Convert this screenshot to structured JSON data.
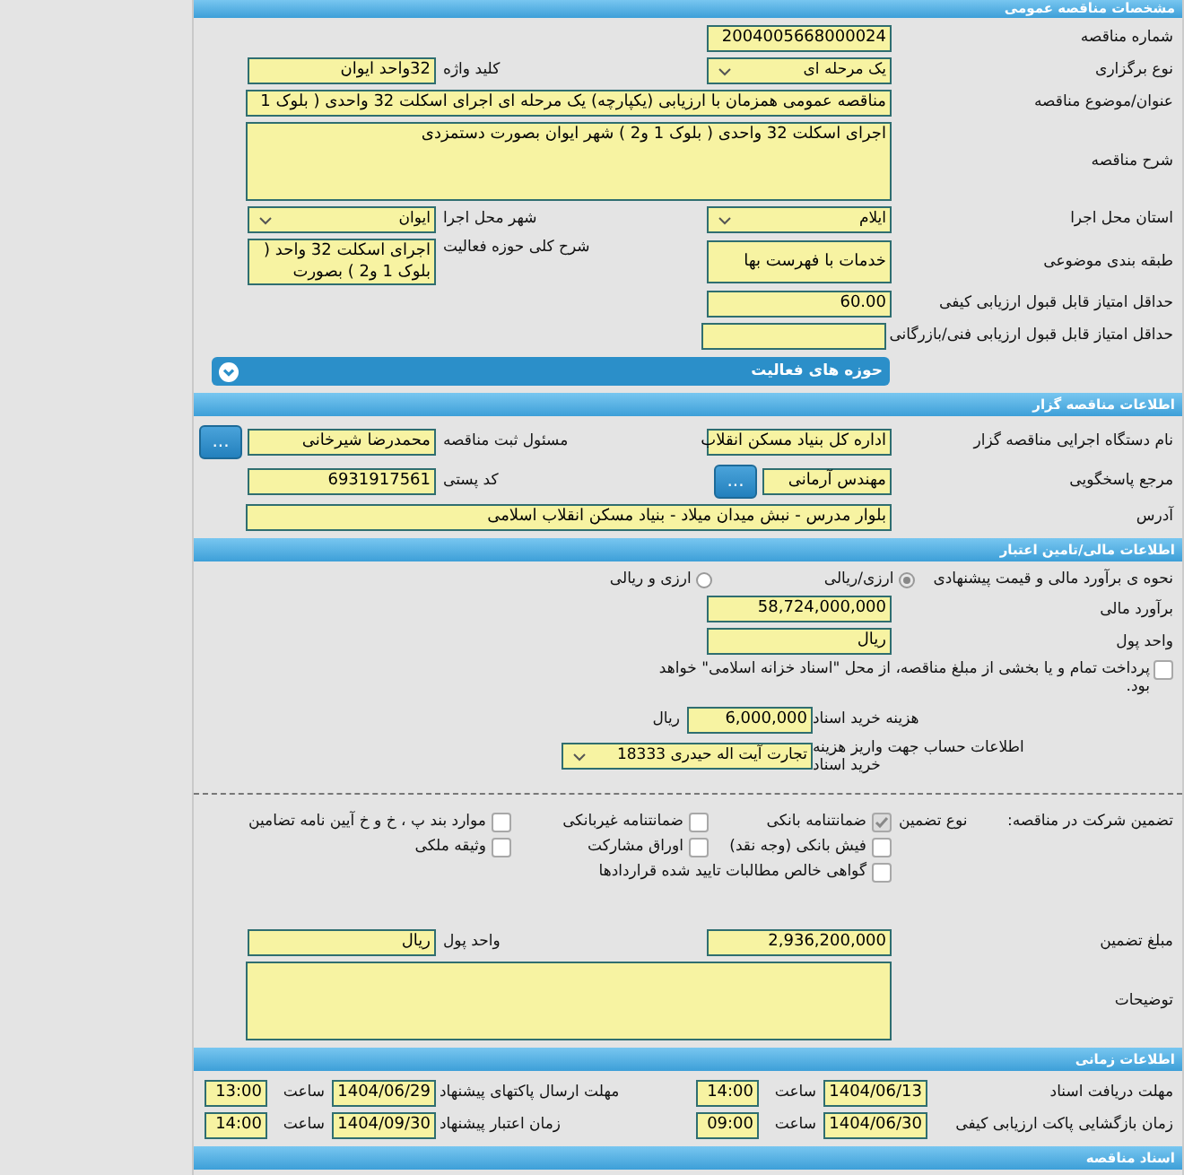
{
  "sections": [
    {
      "title": "مشخصات مناقصه عمومی",
      "rows": [
        {
          "kind": "pair",
          "right": {
            "label": "شماره مناقصه",
            "kind": "text",
            "value": "2004005668000024"
          }
        },
        {
          "kind": "pair",
          "right": {
            "label": "نوع برگزاری",
            "kind": "select",
            "value": "یک مرحله ای"
          },
          "left": {
            "label": "کلید واژه",
            "kind": "text",
            "value": "32واحد ایوان"
          }
        },
        {
          "kind": "wide",
          "label": "عنوان/موضوع مناقصه",
          "field": {
            "kind": "text",
            "value": "مناقصه عمومی همزمان با ارزیابی (یکپارچه) یک مرحله ای اجرای اسکلت 32 واحدی  ( بلوک 1"
          }
        },
        {
          "kind": "wide",
          "label": "شرح مناقصه",
          "field": {
            "kind": "textarea",
            "value": "اجرای اسکلت 32 واحدی  ( بلوک 1 و2 ) شهر ایوان بصورت دستمزدی"
          }
        },
        {
          "kind": "pair",
          "right": {
            "label": "استان محل اجرا",
            "kind": "select",
            "value": "ایلام"
          },
          "left": {
            "label": "شهر محل اجرا",
            "kind": "select",
            "value": "ایوان"
          }
        },
        {
          "kind": "pair",
          "right": {
            "label": "طبقه بندی موضوعی",
            "kind": "text",
            "value": "خدمات با فهرست بها"
          },
          "left": {
            "label": "شرح کلی حوزه فعالیت",
            "kind": "textarea",
            "value": "اجرای اسکلت 32 واحد  ( بلوک 1 و2 ) بصورت"
          }
        },
        {
          "kind": "pair",
          "right": {
            "label": "حداقل امتیاز قابل قبول ارزیابی کیفی",
            "kind": "text",
            "value": "60.00"
          }
        },
        {
          "kind": "pair",
          "right": {
            "label": "حداقل امتیاز قابل قبول ارزیابی فنی/بازرگانی",
            "kind": "text"
          }
        },
        {
          "kind": "collapsible",
          "title": "حوزه های فعالیت",
          "expanded": false
        }
      ]
    },
    {
      "title": "اطلاعات مناقصه گزار",
      "rows": [
        {
          "kind": "pair",
          "right": {
            "label": "نام دستگاه اجرایی مناقصه گزار",
            "kind": "text",
            "value": "اداره کل بنیاد مسکن انقلاب"
          },
          "left": {
            "label": "مسئول ثبت مناقصه",
            "kind": "text",
            "value": "محمدرضا شیرخانی",
            "button": "..."
          }
        },
        {
          "kind": "pair",
          "right": {
            "label": "مرجع پاسخگویی",
            "kind": "text",
            "value": "مهندس آرمانی",
            "button": "..."
          },
          "left": {
            "label": "کد پستی",
            "kind": "text",
            "value": "6931917561"
          }
        },
        {
          "kind": "wide",
          "label": "آدرس",
          "field": {
            "kind": "text",
            "value": "بلوار مدرس - نبش میدان میلاد - بنیاد مسکن انقلاب اسلامی"
          }
        }
      ]
    },
    {
      "title": "اطلاعات مالی/تامین اعتبار",
      "rows": [
        {
          "kind": "radio",
          "label": "نحوه ی برآورد مالی و قیمت پیشنهادی",
          "options": [
            {
              "label": "ارزی/ریالی",
              "selected": true
            },
            {
              "label": "ارزی و ریالی",
              "selected": false
            }
          ]
        },
        {
          "kind": "pair",
          "right": {
            "label": "برآورد مالی",
            "kind": "text",
            "value": "58,724,000,000"
          }
        },
        {
          "kind": "pair",
          "right": {
            "label": "واحد پول",
            "kind": "text",
            "value": "ریال"
          }
        },
        {
          "kind": "check_note",
          "checked": false,
          "text": "پرداخت تمام و یا بخشی از مبلغ مناقصه، از محل \"اسناد خزانه اسلامی\" خواهد بود."
        },
        {
          "kind": "amount",
          "label": "هزینه خرید اسناد",
          "field": {
            "kind": "text",
            "value": "6,000,000"
          },
          "unit": "ریال"
        },
        {
          "kind": "amount",
          "label": "اطلاعات حساب جهت واریز هزینه خرید اسناد",
          "field": {
            "kind": "select",
            "value": "تجارت آیت اله حیدری 18333"
          }
        },
        {
          "kind": "divider"
        },
        {
          "kind": "guarantee",
          "label": "تضمین شرکت در مناقصه:",
          "type_label": "نوع تضمین",
          "options": [
            {
              "label": "ضمانتنامه بانکی",
              "checked": true
            },
            {
              "label": "ضمانتنامه غیربانکی",
              "checked": false
            },
            {
              "label": "موارد بند پ ، خ و خ آیین نامه تضامین",
              "checked": false
            },
            {
              "label": "فیش بانکی (وجه نقد)",
              "checked": false
            },
            {
              "label": "اوراق مشارکت",
              "checked": false
            },
            {
              "label": "وثیقه ملکی",
              "checked": false
            },
            {
              "label": "گواهی خالص مطالبات تایید شده قراردادها",
              "checked": false
            }
          ]
        },
        {
          "kind": "pair",
          "right": {
            "label": "مبلغ تضمین",
            "kind": "text",
            "value": "2,936,200,000"
          },
          "left": {
            "label": "واحد پول",
            "kind": "text",
            "value": "ریال"
          }
        },
        {
          "kind": "wide",
          "label": "توضیحات",
          "field": {
            "kind": "textarea"
          }
        }
      ]
    },
    {
      "title": "اطلاعات زمانی",
      "rows": [
        {
          "kind": "times",
          "items": [
            {
              "label": "مهلت دریافت اسناد",
              "date": "1404/06/13",
              "time_label": "ساعت",
              "time": "14:00"
            },
            {
              "label": "مهلت ارسال پاکتهای پیشنهاد",
              "date": "1404/06/29",
              "time_label": "ساعت",
              "time": "13:00"
            }
          ]
        },
        {
          "kind": "times",
          "items": [
            {
              "label": "زمان بازگشایی پاکت ارزیابی کیفی",
              "date": "1404/06/30",
              "time_label": "ساعت",
              "time": "09:00"
            },
            {
              "label": "زمان اعتبار پیشنهاد",
              "date": "1404/09/30",
              "time_label": "ساعت",
              "time": "14:00"
            }
          ]
        }
      ]
    },
    {
      "title": "اسناد مناقصه"
    }
  ]
}
